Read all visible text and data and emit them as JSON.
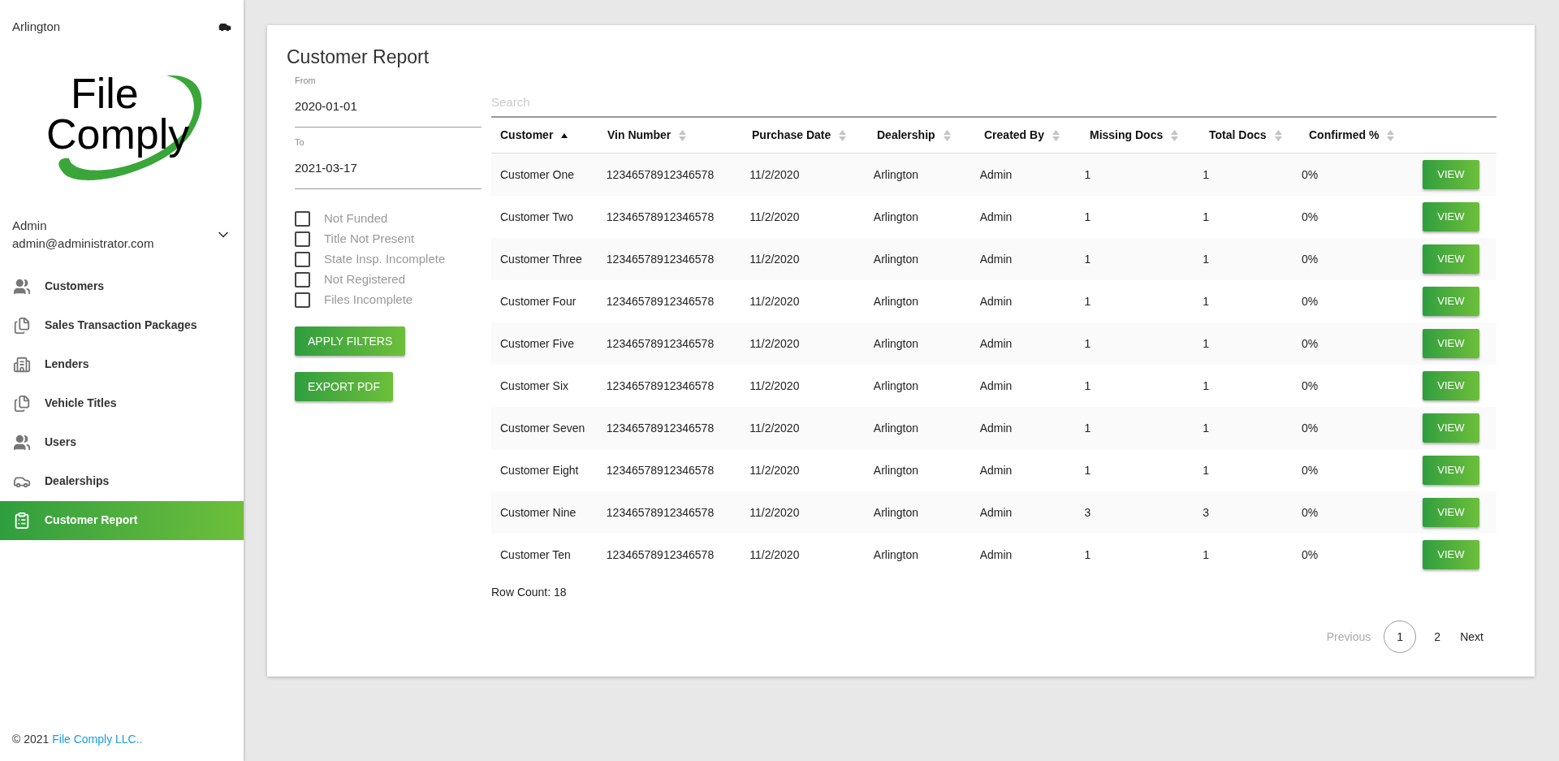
{
  "sidebar": {
    "location": "Arlington",
    "logo": {
      "line_1": "File",
      "line_2": "Comply"
    },
    "user": {
      "name": "Admin",
      "email": "admin@administrator.com"
    },
    "items": [
      {
        "label": "Customers",
        "kind": "people",
        "selected": false
      },
      {
        "label": "Sales Transaction Packages",
        "kind": "docs",
        "selected": false
      },
      {
        "label": "Lenders",
        "kind": "building",
        "selected": false
      },
      {
        "label": "Vehicle Titles",
        "kind": "docs",
        "selected": false
      },
      {
        "label": "Users",
        "kind": "people",
        "selected": false
      },
      {
        "label": "Dealerships",
        "kind": "car",
        "selected": false
      },
      {
        "label": "Customer Report",
        "kind": "clipboard",
        "selected": true
      }
    ],
    "footer": {
      "prefix": "© 2021",
      "link": "File Comply LLC.."
    }
  },
  "page": {
    "title": "Customer Report",
    "filters": {
      "from": {
        "label": "From",
        "value": "2020-01-01"
      },
      "to": {
        "label": "To",
        "value": "2021-03-17"
      },
      "checkboxes": [
        {
          "label": "Not Funded",
          "checked": false
        },
        {
          "label": "Title Not Present",
          "checked": false
        },
        {
          "label": "State Insp. Incomplete",
          "checked": false
        },
        {
          "label": "Not Registered",
          "checked": false
        },
        {
          "label": "Files Incomplete",
          "checked": false
        }
      ],
      "buttons": [
        "APPLY FILTERS",
        "EXPORT PDF"
      ]
    },
    "search": {
      "placeholder": "Search"
    },
    "table": {
      "columns": [
        {
          "label": "Customer",
          "sorted": true
        },
        {
          "label": "Vin Number",
          "sorted": false
        },
        {
          "label": "Purchase Date",
          "sorted": false
        },
        {
          "label": "Dealership",
          "sorted": false
        },
        {
          "label": "Created By",
          "sorted": false
        },
        {
          "label": "Missing Docs",
          "sorted": false
        },
        {
          "label": "Total Docs",
          "sorted": false
        },
        {
          "label": "Confirmed %",
          "sorted": false
        }
      ],
      "rows": [
        {
          "cells": [
            "Customer One",
            "12346578912346578",
            "11/2/2020",
            "Arlington",
            "Admin",
            "1",
            "1",
            "0%"
          ],
          "action": "VIEW"
        },
        {
          "cells": [
            "Customer Two",
            "12346578912346578",
            "11/2/2020",
            "Arlington",
            "Admin",
            "1",
            "1",
            "0%"
          ],
          "action": "VIEW"
        },
        {
          "cells": [
            "Customer Three",
            "12346578912346578",
            "11/2/2020",
            "Arlington",
            "Admin",
            "1",
            "1",
            "0%"
          ],
          "action": "VIEW"
        },
        {
          "cells": [
            "Customer Four",
            "12346578912346578",
            "11/2/2020",
            "Arlington",
            "Admin",
            "1",
            "1",
            "0%"
          ],
          "action": "VIEW"
        },
        {
          "cells": [
            "Customer Five",
            "12346578912346578",
            "11/2/2020",
            "Arlington",
            "Admin",
            "1",
            "1",
            "0%"
          ],
          "action": "VIEW"
        },
        {
          "cells": [
            "Customer Six",
            "12346578912346578",
            "11/2/2020",
            "Arlington",
            "Admin",
            "1",
            "1",
            "0%"
          ],
          "action": "VIEW"
        },
        {
          "cells": [
            "Customer Seven",
            "12346578912346578",
            "11/2/2020",
            "Arlington",
            "Admin",
            "1",
            "1",
            "0%"
          ],
          "action": "VIEW"
        },
        {
          "cells": [
            "Customer Eight",
            "12346578912346578",
            "11/2/2020",
            "Arlington",
            "Admin",
            "1",
            "1",
            "0%"
          ],
          "action": "VIEW"
        },
        {
          "cells": [
            "Customer Nine",
            "12346578912346578",
            "11/2/2020",
            "Arlington",
            "Admin",
            "3",
            "3",
            "0%"
          ],
          "action": "VIEW"
        },
        {
          "cells": [
            "Customer Ten",
            "12346578912346578",
            "11/2/2020",
            "Arlington",
            "Admin",
            "1",
            "1",
            "0%"
          ],
          "action": "VIEW"
        }
      ]
    },
    "row_count": "Row Count: 18",
    "pagination": {
      "previous": {
        "label": "Previous",
        "disabled": true
      },
      "pages": [
        {
          "label": "1",
          "selected": true
        },
        {
          "label": "2",
          "selected": false
        }
      ],
      "next": {
        "label": "Next",
        "disabled": false
      }
    }
  }
}
